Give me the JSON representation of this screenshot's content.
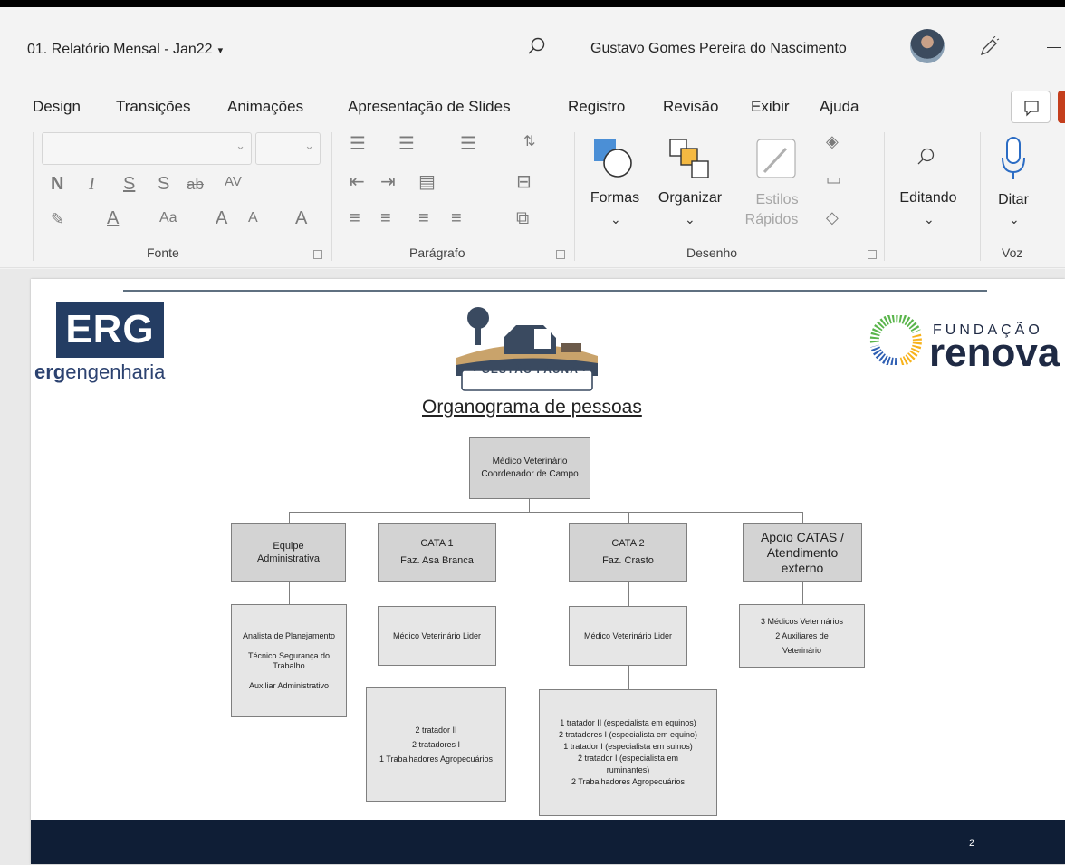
{
  "titlebar": {
    "doc_title": "01. Relatório Mensal - Jan22",
    "user_name": "Gustavo Gomes Pereira do Nascimento"
  },
  "tabs": [
    "Design",
    "Transições",
    "Animações",
    "Apresentação de Slides",
    "Registro",
    "Revisão",
    "Exibir",
    "Ajuda"
  ],
  "ribbon": {
    "font_group": "Fonte",
    "font_buttons": {
      "bold": "N",
      "italic": "I",
      "underline": "S",
      "strike": "S",
      "strike2": "ab",
      "spacing": "AV",
      "color": "A",
      "case": "Aa",
      "grow": "A",
      "shrink": "A"
    },
    "paragraph_group": "Parágrafo",
    "drawing_group": "Desenho",
    "shapes": "Formas",
    "arrange": "Organizar",
    "quick_styles_1": "Estilos",
    "quick_styles_2": "Rápidos",
    "editing": "Editando",
    "dictate": "Ditar",
    "voice_group": "Voz"
  },
  "slide": {
    "erg_logo": "ERG",
    "erg_sub_bold": "erg",
    "erg_sub": "engenharia",
    "gestao_fauna": "• GESTÃO FAUNA •",
    "renova_top": "FUNDAÇÃO",
    "renova_big": "renova",
    "title": "Organograma de pessoas",
    "page_number": "2"
  },
  "org": {
    "root": "Médico Veterinário\nCoordenador de Campo",
    "col1_head": "Equipe\nAdministrativa",
    "col1_detail": "Analista de Planejamento\n\nTécnico Segurança do\nTrabalho\n\nAuxiliar Administrativo",
    "col2_head": "CATA 1\nFaz. Asa Branca",
    "col2_mid": "Médico Veterinário Lider",
    "col2_detail": "2 tratador II\n2 tratadores I\n1 Trabalhadores Agropecuários",
    "col3_head": "CATA 2\nFaz. Crasto",
    "col3_mid": "Médico Veterinário Lider",
    "col3_detail": "1 tratador II (especialista em equinos)\n2 tratadores I (especialista em equino)\n1 tratador I (especialista em suinos)\n2 tratador I (especialista em\nruminantes)\n2 Trabalhadores Agropecuários",
    "col4_head": "Apoio CATAS /\nAtendimento\nexterno",
    "col4_detail": "3 Médicos Veterinários\n2 Auxiliares de\nVeterinário"
  }
}
